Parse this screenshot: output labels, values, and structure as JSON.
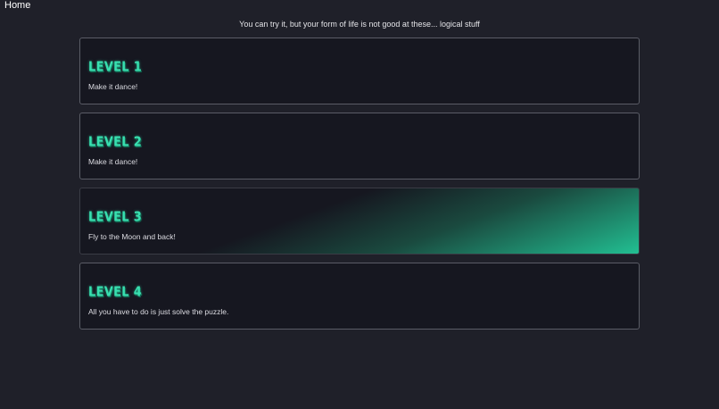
{
  "nav": {
    "home_label": "Home"
  },
  "tagline": "You can try it, but your form of life is not good at these... logical stuff",
  "colors": {
    "background": "#1f2029",
    "card_background": "#161720",
    "card_border": "#5a5c66",
    "accent": "#38e0b0"
  },
  "levels": [
    {
      "title": "Level 1",
      "description": "Make it dance!"
    },
    {
      "title": "Level 2",
      "description": "Make it dance!"
    },
    {
      "title": "Level 3",
      "description": "Fly to the Moon and back!"
    },
    {
      "title": "Level 4",
      "description": "All you have to do is just solve the puzzle."
    }
  ]
}
